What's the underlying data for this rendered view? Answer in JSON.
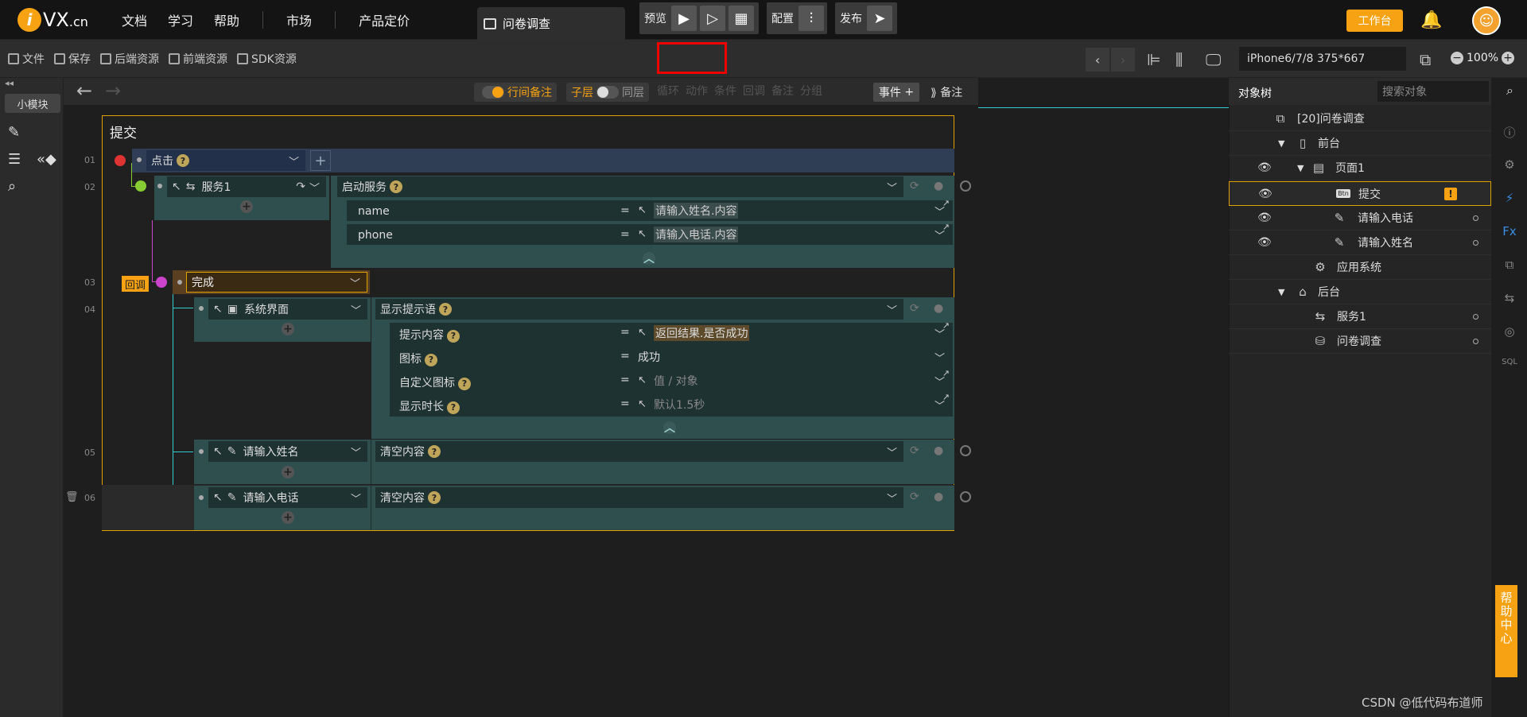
{
  "brand": {
    "logo_i": "i",
    "logo_text": "VX",
    "logo_tld": ".cn"
  },
  "topnav": {
    "docs": "文档",
    "learn": "学习",
    "help": "帮助",
    "market": "市场",
    "pricing": "产品定价"
  },
  "tab": {
    "title": "问卷调查"
  },
  "top_right": {
    "workbench": "工作台"
  },
  "toolbar": {
    "file": "文件",
    "save": "保存",
    "backend": "后端资源",
    "frontend": "前端资源",
    "sdk": "SDK资源",
    "preview": "预览",
    "config": "配置",
    "publish": "发布",
    "device": "iPhone6/7/8 375*667",
    "zoom": "100%"
  },
  "left_rail": {
    "module": "小模块"
  },
  "canvas_head": {
    "row_remark": "行间备注",
    "child_layer": "子层",
    "same_layer": "同层",
    "filters": [
      "循环",
      "动作",
      "条件",
      "回调",
      "备注",
      "分组"
    ],
    "event": "事件",
    "remark": "备注"
  },
  "event": {
    "title": "提交",
    "rows": [
      "01",
      "02",
      "03",
      "04",
      "05",
      "06"
    ],
    "trigger": "点击",
    "service_target": "服务1",
    "service_action": "启动服务",
    "params1": [
      {
        "label": "name",
        "value": "请输入姓名.内容"
      },
      {
        "label": "phone",
        "value": "请输入电话.内容"
      }
    ],
    "callback_tag": "回调",
    "callback_value": "完成",
    "sys_target": "系统界面",
    "sys_action": "显示提示语",
    "params2": [
      {
        "label": "提示内容",
        "value": "返回结果.是否成功"
      },
      {
        "label": "图标",
        "value": "成功"
      },
      {
        "label": "自定义图标",
        "value": "值 / 对象"
      },
      {
        "label": "显示时长",
        "value": "默认1.5秒"
      }
    ],
    "name_target": "请输入姓名",
    "phone_target": "请输入电话",
    "clear_action": "清空内容"
  },
  "right_panel": {
    "tab": "对象树",
    "search_placeholder": "搜索对象",
    "tree": [
      "[20]问卷调查",
      "前台",
      "页面1",
      "提交",
      "请输入电话",
      "请输入姓名",
      "应用系统",
      "后台",
      "服务1",
      "问卷调查"
    ],
    "btn_badge": "Btn"
  },
  "help_center": "帮助中心",
  "watermark": "CSDN @低代码布道师",
  "colors": {
    "accent": "#f7a212",
    "highlight": "#e00000",
    "block": "#2f4f4f"
  }
}
